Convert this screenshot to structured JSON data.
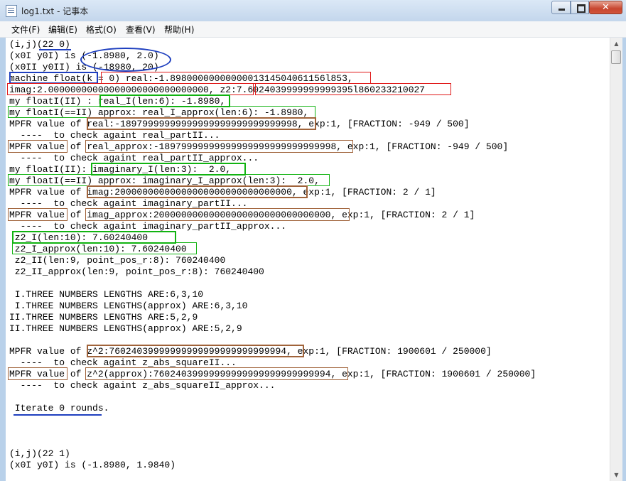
{
  "window": {
    "title": "log1.txt - 记事本",
    "close_glyph": "✕"
  },
  "menu": [
    "文件(F)",
    "编辑(E)",
    "格式(O)",
    "查看(V)",
    "帮助(H)"
  ],
  "scrollbar": {
    "up_glyph": "▲",
    "down_glyph": "▼"
  },
  "lines": [
    "(i,j)(22 0)",
    "(x0I y0I) is (-1.8980, 2.0)",
    "(x0II y0II) is (-18980, 20)",
    "machine float(k = 0) real:-1.8980000000000001314504061156l853,",
    "imag:2.00000000000000000000000000000, z2:7.6024039999999999395l860233210027",
    "my floatI(II) : real_I(len:6): -1.8980,",
    "my floatI(==II) approx: real_I_approx(len:6): -1.8980,",
    "MPFR value of real:-18979999999999999999999999999998, exp:1, [FRACTION: -949 / 500]",
    "  ----  to check againt real_partII...",
    "MPFR value of real_approx:-18979999999999999999999999999998, exp:1, [FRACTION: -949 / 500]",
    "  ----  to check againt real_partII_approx...",
    "my floatI(II): imaginary_I(len:3):  2.0,",
    "my floatI(==II) approx: imaginary_I_approx(len:3):  2.0,",
    "MPFR value of imag:20000000000000000000000000000000, exp:1, [FRACTION: 2 / 1]",
    "  ----  to check againt imaginary_partII...",
    "MPFR value of imag_approx:20000000000000000000000000000000, exp:1, [FRACTION: 2 / 1]",
    "  ----  to check againt imaginary_partII_approx...",
    " z2_I(len:10): 7.60240400",
    " z2_I_approx(len:10): 7.60240400",
    " z2_II(len:9, point_pos_r:8): 760240400",
    " z2_II_approx(len:9, point_pos_r:8): 760240400",
    "",
    " I.THREE NUMBERS LENGTHS ARE:6,3,10",
    " I.THREE NUMBERS LENGTHS(approx) ARE:6,3,10",
    "II.THREE NUMBERS LENGTHS ARE:5,2,9",
    "II.THREE NUMBERS LENGTHS(approx) ARE:5,2,9",
    "",
    "MPFR value of z^2:76024039999999999999999999999994, exp:1, [FRACTION: 1900601 / 250000]",
    "  ----  to check againt z_abs_squareII...",
    "MPFR value of z^2(approx):76024039999999999999999999999994, exp:1, [FRACTION: 1900601 / 250000]",
    "  ----  to check againt z_abs_squareII_approx...",
    "",
    " Iterate 0 rounds.",
    "",
    "",
    "",
    "(i,j)(22 1)",
    "(x0I y0I) is (-1.8980, 1.9840)"
  ]
}
